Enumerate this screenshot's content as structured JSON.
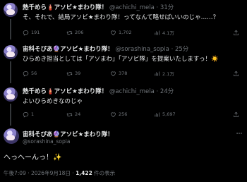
{
  "tweets": [
    {
      "name": "熱千めら🧯アソビ★まわり隊！",
      "handle": "@achichi_mela",
      "time": "31分",
      "text": "そ、それで、結局アソビ★まわり隊！ってなんて略せばいいのじゃ……？",
      "replies": "191",
      "retweets": "206",
      "likes": "1,702",
      "views": "4.1万"
    },
    {
      "name": "宙科そぴあ🔮アソビ★まわり隊！",
      "handle": "@sorashina_sopia",
      "time": "25分",
      "text": "ひらめき担当としては「アソまわ」「アソビ隊」を提案いたしますっ！☀️",
      "replies": "56",
      "retweets": "39",
      "likes": "378",
      "views": "2.1万"
    },
    {
      "name": "熱千めら🧯アソビ★まわり隊！",
      "handle": "@achichi_mela",
      "time": "24分",
      "text": "よいひらめきなのじゃ",
      "replies": "1",
      "retweets": "24",
      "likes": "256",
      "views": "5,697"
    }
  ],
  "main_tweet": {
    "name": "宙科そぴあ🔮アソビ★まわり隊！",
    "handle": "@sorashina_sopia",
    "text": "へっへーんっ！✨",
    "timestamp": "午後7:09 · 2026年9月18日 · ",
    "views_count": "1,422",
    "views_label": " 件の表示"
  },
  "icons": {
    "reply": "reply-icon",
    "retweet": "retweet-icon",
    "like": "heart-icon",
    "views": "views-icon",
    "share": "share-icon",
    "more": "more-icon"
  }
}
